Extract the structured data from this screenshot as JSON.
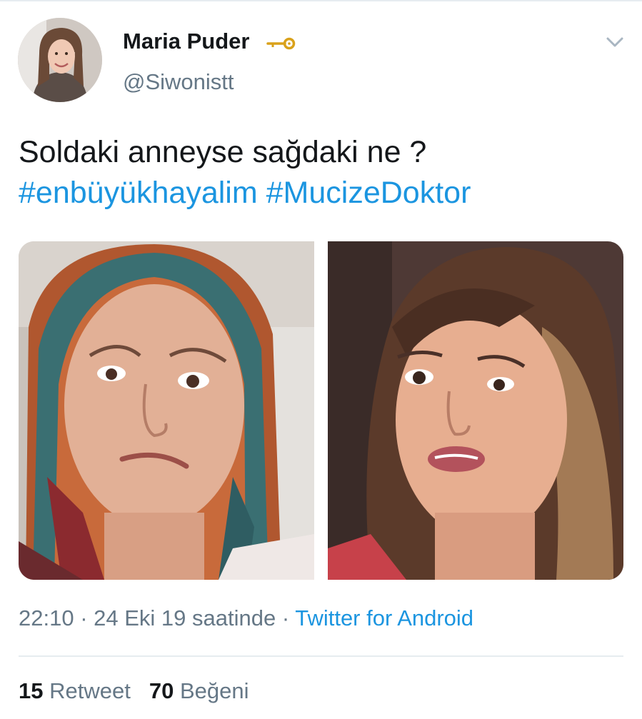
{
  "user": {
    "display_name": "Maria Puder",
    "badge_icon": "key-icon",
    "handle": "@Siwonistt"
  },
  "tweet": {
    "text": "Soldaki anneyse sağdaki ne ?",
    "hashtags": [
      "#enbüyükhayalim",
      "#MucizeDoktor"
    ]
  },
  "media": [
    {
      "description_icon": "photo-crying-woman-headscarf"
    },
    {
      "description_icon": "photo-woman-speaking"
    }
  ],
  "meta": {
    "time": "22:10",
    "separator": " · ",
    "date": "24 Eki 19 saatinde",
    "source": "Twitter for Android"
  },
  "stats": {
    "retweets_count": "15",
    "retweets_label": "Retweet",
    "likes_count": "70",
    "likes_label": "Beğeni"
  },
  "colors": {
    "link": "#1b95e0",
    "secondary_text": "#657786",
    "primary_text": "#14171a",
    "divider": "#e6ecf0"
  }
}
